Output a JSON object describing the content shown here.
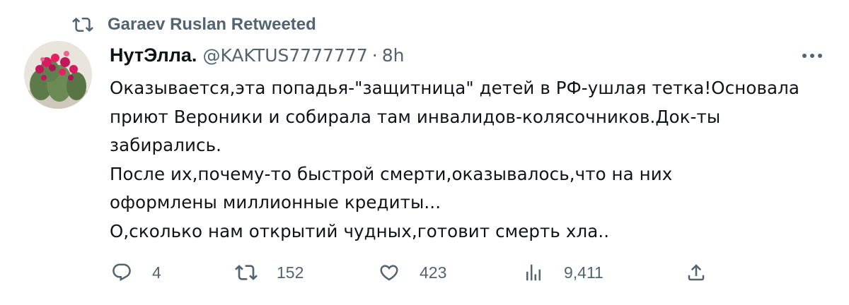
{
  "retweet_context": {
    "icon": "retweet-icon",
    "text": "Garaev Ruslan Retweeted"
  },
  "author": {
    "display_name": "НутЭлла.",
    "handle": "@KAKTUS7777777",
    "separator": "·",
    "time": "8h",
    "avatar": "cactus-avatar"
  },
  "tweet": {
    "lines": [
      "Оказывается,эта попадья-\"защитница\" детей в РФ-ушлая тетка!Основала",
      "приют Вероники и собирала там инвалидов-колясочников.Док-ты",
      "забирались.",
      "После их,почему-то быстрой смерти,оказывалось,что на них",
      "оформлены миллионные кредиты...",
      "О,сколько нам открытий чудных,готовит смерть хла.."
    ]
  },
  "actions": {
    "reply": {
      "icon": "reply-icon",
      "count": "4"
    },
    "retweet": {
      "icon": "retweet-icon",
      "count": "152"
    },
    "like": {
      "icon": "heart-icon",
      "count": "423"
    },
    "views": {
      "icon": "views-icon",
      "count": "9,411"
    },
    "share": {
      "icon": "share-icon"
    }
  },
  "colors": {
    "text_primary": "#0f1419",
    "text_secondary": "#536471",
    "background": "#ffffff"
  }
}
